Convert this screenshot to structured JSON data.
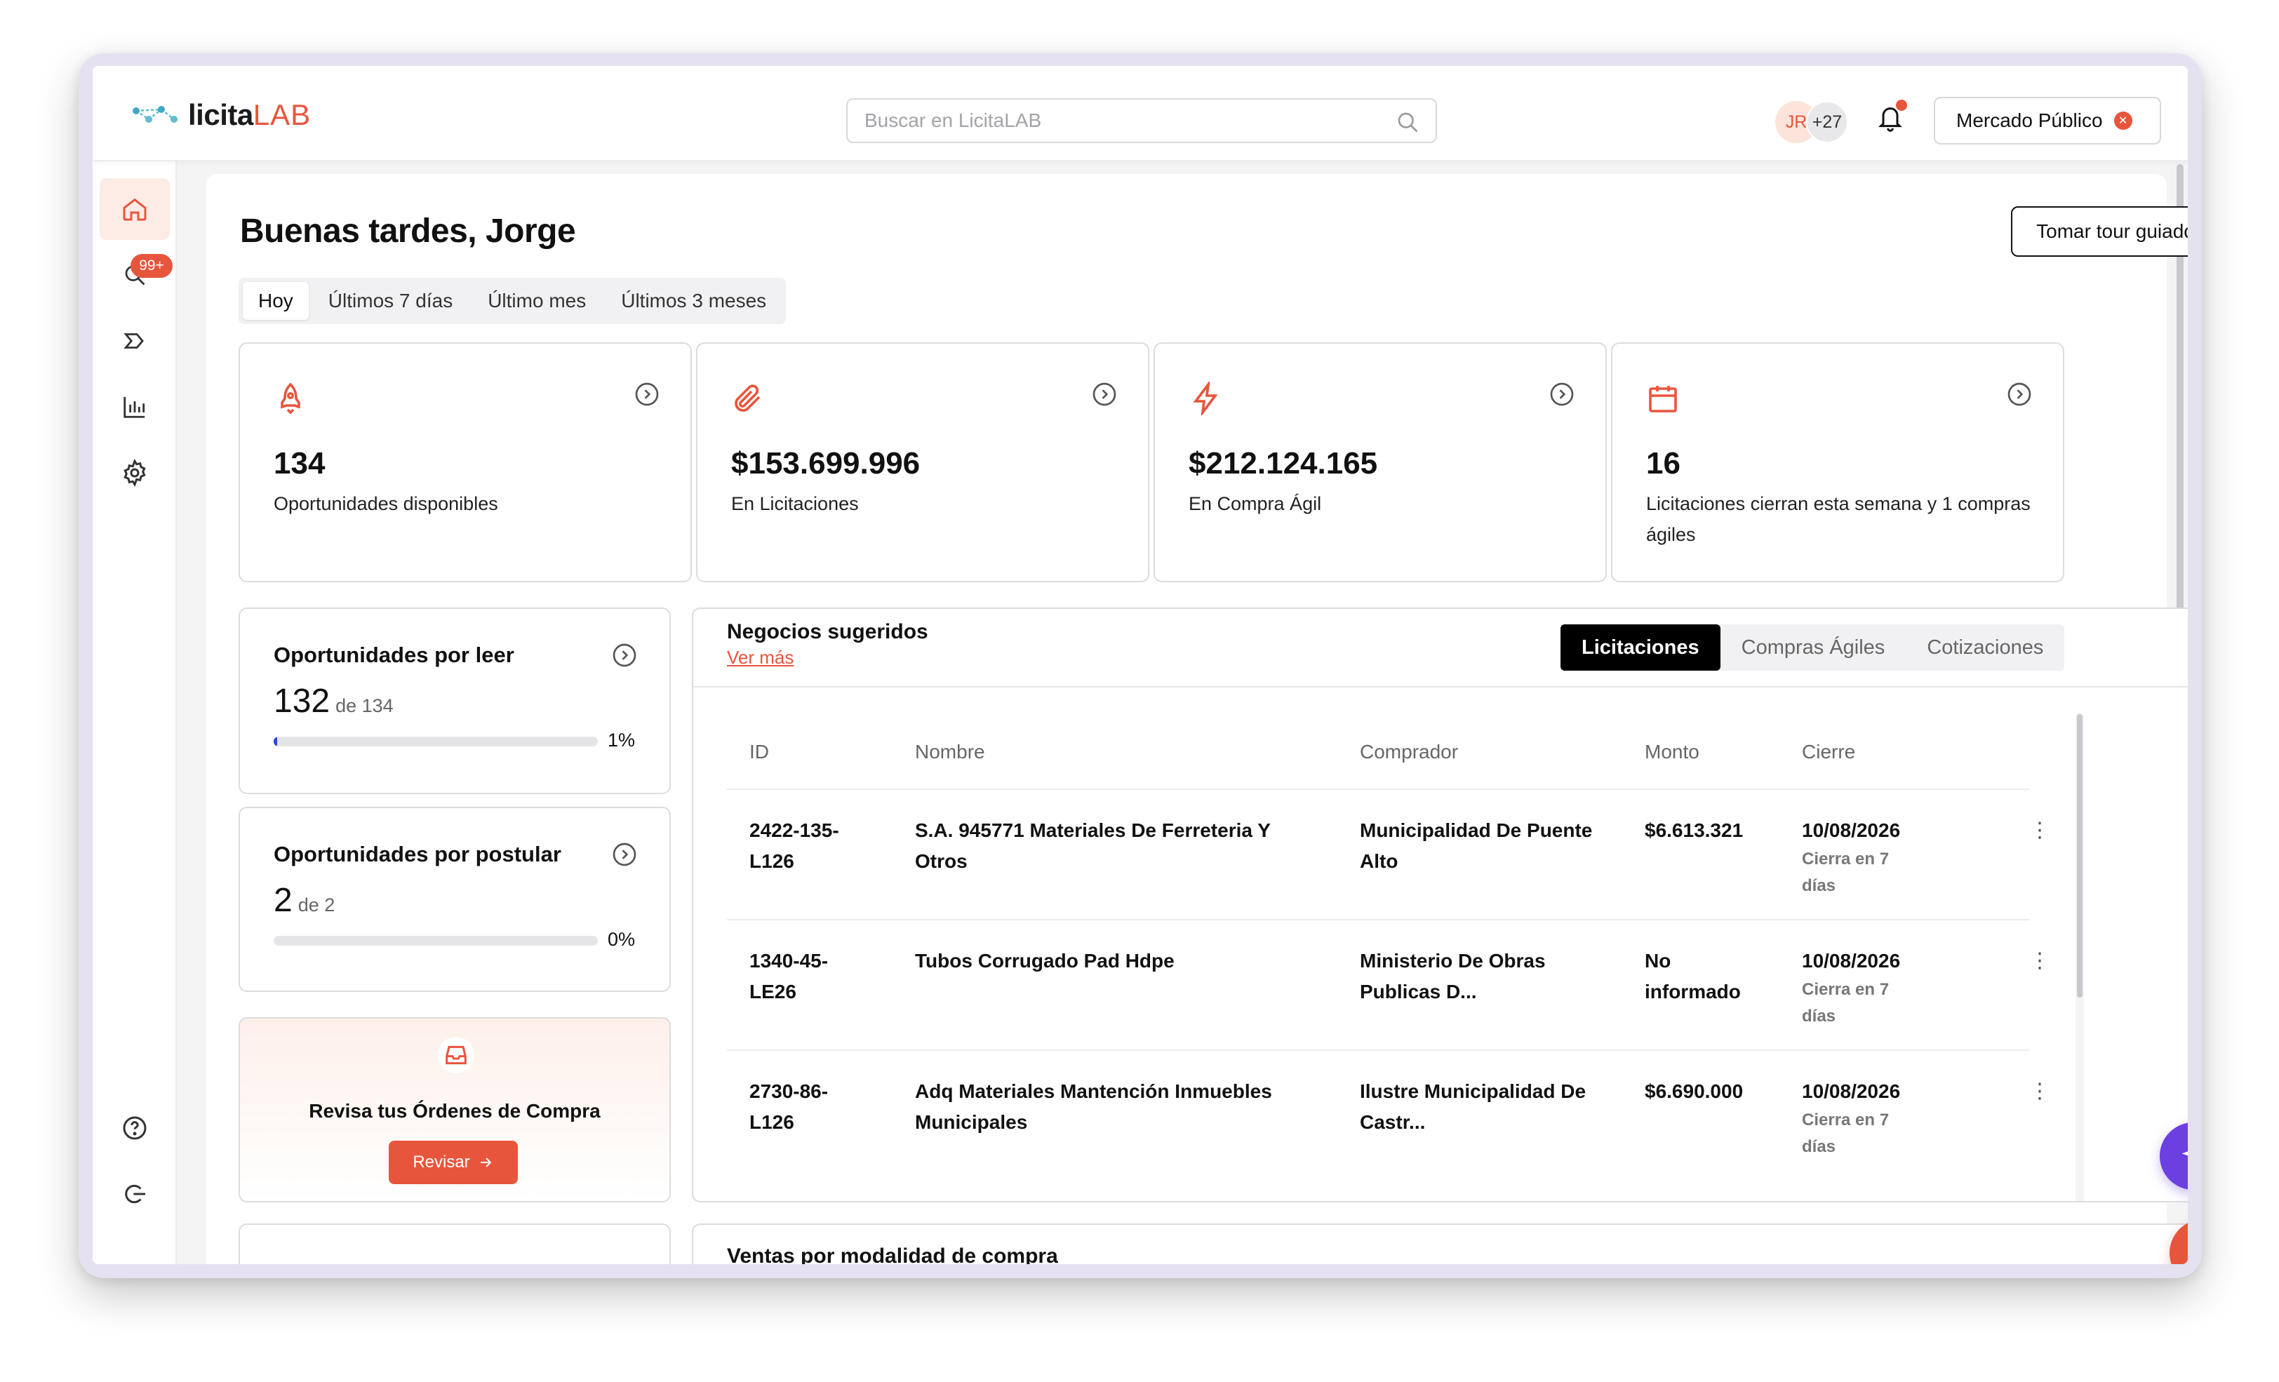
{
  "brand": {
    "name_part1": "licita",
    "name_part2": "LAB",
    "accent": "#e8553d"
  },
  "search": {
    "placeholder": "Buscar en LicitaLAB"
  },
  "header": {
    "avatar_initials": "JR",
    "avatar_more": "+27",
    "market_button": "Mercado Público"
  },
  "sidebar": {
    "items": [
      {
        "name": "home",
        "icon": "home-icon",
        "active": true
      },
      {
        "name": "search",
        "icon": "search-icon",
        "badge": "99+"
      },
      {
        "name": "pipeline",
        "icon": "chevron-flow-icon"
      },
      {
        "name": "analytics",
        "icon": "bar-chart-icon"
      },
      {
        "name": "settings",
        "icon": "gear-icon"
      }
    ],
    "bottom": [
      {
        "name": "help",
        "icon": "help-icon"
      },
      {
        "name": "logout",
        "icon": "logout-icon"
      }
    ]
  },
  "main": {
    "greeting": "Buenas tardes, Jorge",
    "tour_button": "Tomar tour guiado",
    "range_tabs": [
      "Hoy",
      "Últimos 7 días",
      "Último mes",
      "Últimos 3 meses"
    ],
    "range_active": "Hoy",
    "stats": [
      {
        "icon": "rocket-icon",
        "value": "134",
        "label": "Oportunidades disponibles"
      },
      {
        "icon": "paperclip-icon",
        "value": "$153.699.996",
        "label": "En Licitaciones"
      },
      {
        "icon": "lightning-icon",
        "value": "$212.124.165",
        "label": "En Compra Ágil"
      },
      {
        "icon": "calendar-icon",
        "value": "16",
        "label": "Licitaciones cierran esta semana y 1 compras ágiles"
      }
    ],
    "to_read": {
      "title": "Oportunidades por leer",
      "count": "132",
      "of": "de 134",
      "pct": "1%",
      "fraction": 0.01
    },
    "to_apply": {
      "title": "Oportunidades por postular",
      "count": "2",
      "of": "de 2",
      "pct": "0%",
      "fraction": 0
    },
    "orders": {
      "text": "Revisa tus Órdenes de Compra",
      "button": "Revisar"
    },
    "suggested": {
      "title": "Negocios sugeridos",
      "see_more": "Ver más",
      "tabs": [
        "Licitaciones",
        "Compras Ágiles",
        "Cotizaciones"
      ],
      "active_tab": "Licitaciones",
      "columns": [
        "ID",
        "Nombre",
        "Comprador",
        "Monto",
        "Cierre"
      ],
      "rows": [
        {
          "id": "2422-135-L126",
          "id_l1": "2422-135-",
          "id_l2": "L126",
          "name_l1": "S.A. 945771 Materiales De Ferreteria Y",
          "name_l2": "Otros",
          "buyer_l1": "Municipalidad De Puente",
          "buyer_l2": "Alto",
          "amount_l1": "$6.613.321",
          "amount_l2": "",
          "close": "10/08/2026",
          "close_sub_l1": "Cierra en 7",
          "close_sub_l2": "días"
        },
        {
          "id": "1340-45-LE26",
          "id_l1": "1340-45-",
          "id_l2": "LE26",
          "name_l1": "Tubos Corrugado Pad Hdpe",
          "name_l2": "",
          "buyer_l1": "Ministerio De Obras",
          "buyer_l2": "Publicas D...",
          "amount_l1": "No",
          "amount_l2": "informado",
          "close": "10/08/2026",
          "close_sub_l1": "Cierra en 7",
          "close_sub_l2": "días"
        },
        {
          "id": "2730-86-L126",
          "id_l1": "2730-86-",
          "id_l2": "L126",
          "name_l1": "Adq Materiales Mantención Inmuebles",
          "name_l2": "Municipales",
          "buyer_l1": "Ilustre Municipalidad De",
          "buyer_l2": "Castr...",
          "amount_l1": "$6.690.000",
          "amount_l2": "",
          "close": "10/08/2026",
          "close_sub_l1": "Cierra en 7",
          "close_sub_l2": "días"
        }
      ]
    },
    "bottom_section_title": "Ventas por modalidad de compra"
  },
  "colors": {
    "accent": "#e8553d",
    "ai_button": "#6b3fe0",
    "progress": "#2a48d6"
  }
}
